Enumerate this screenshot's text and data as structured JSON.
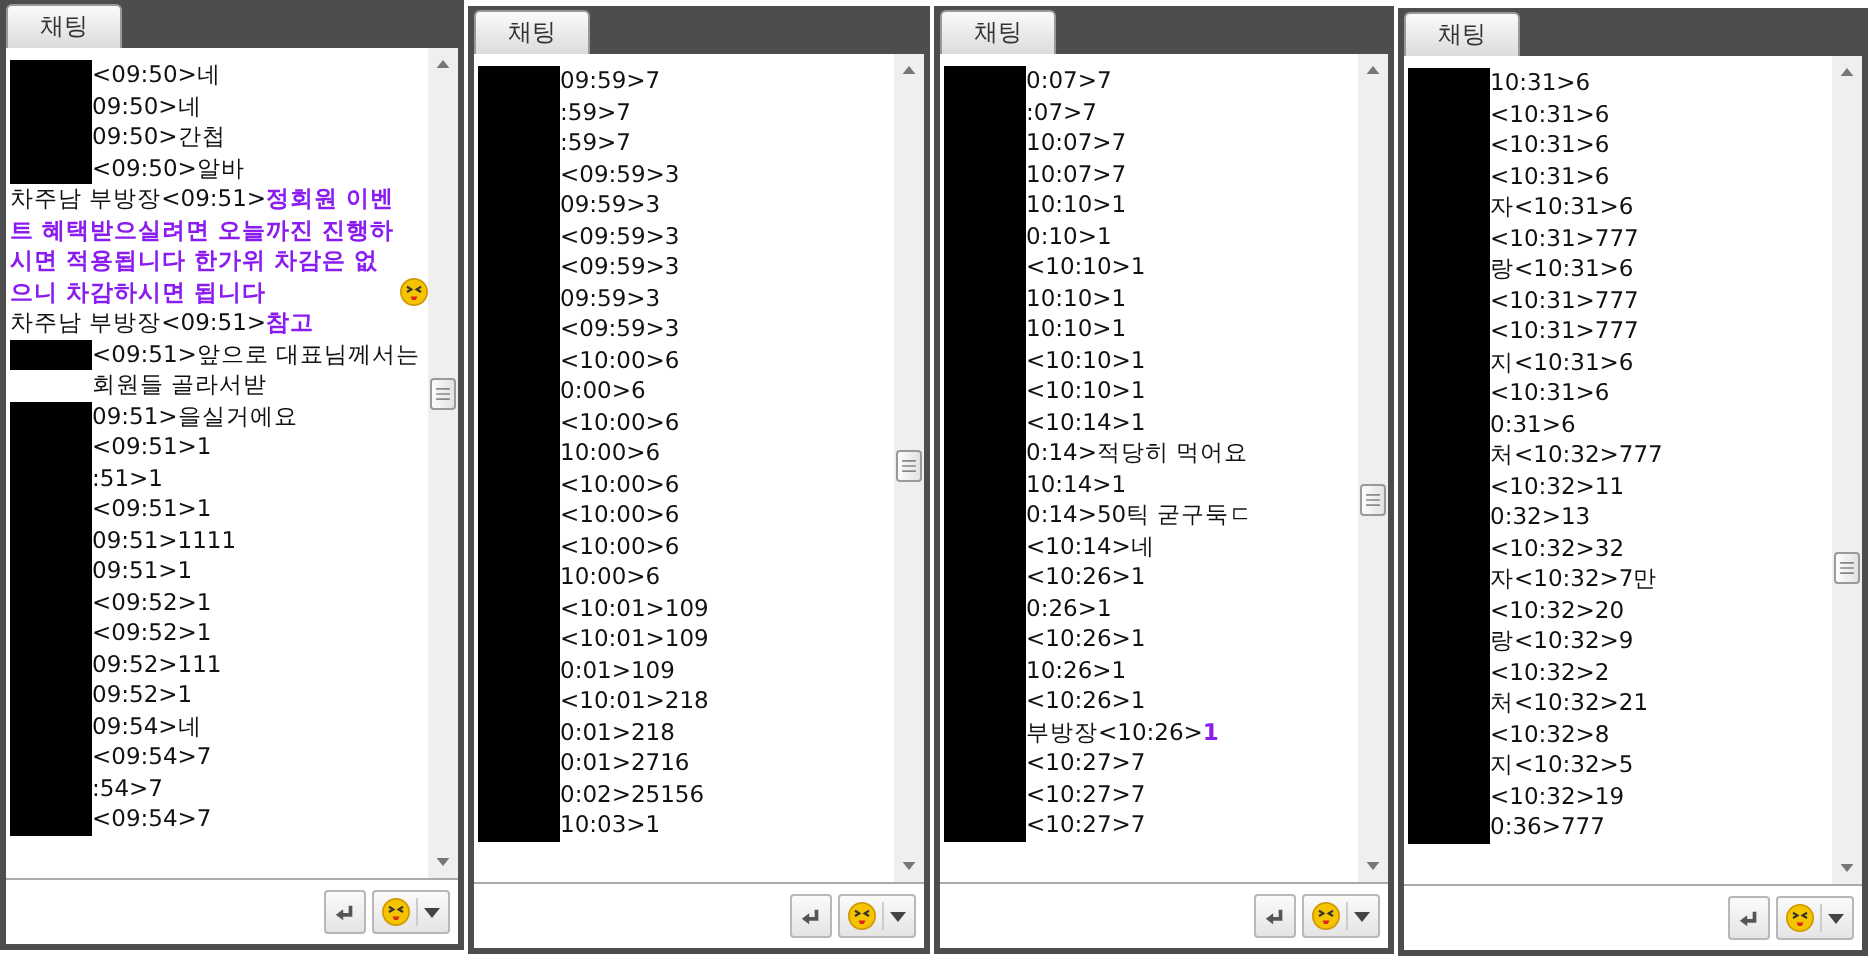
{
  "panels": [
    {
      "tab": "채팅",
      "messages": [
        {
          "redacted": true,
          "text": "<09:50>네"
        },
        {
          "redacted": true,
          "text": "09:50>네"
        },
        {
          "redacted": true,
          "text": "09:50>간첩"
        },
        {
          "redacted": true,
          "text": "<09:50>알바"
        },
        {
          "redacted": false,
          "text": "차주남 부방장<09:51>",
          "notice": "정회원 이벤트 혜택받으실려면 오늘까진 진행하시면 적용됩니다 한가위 차감은 없으니 차감하시면 됩니다",
          "emoticon": true
        },
        {
          "redacted": false,
          "text": "차주남 부방장<09:51>",
          "notice": "참고"
        },
        {
          "redacted": true,
          "text": "<09:51>앞으로 대표님께서는 회원들 골라서받"
        },
        {
          "redacted": true,
          "text": "09:51>을실거에요"
        },
        {
          "redacted": true,
          "text": "<09:51>1"
        },
        {
          "redacted": true,
          "text": ":51>1"
        },
        {
          "redacted": true,
          "text": "<09:51>1"
        },
        {
          "redacted": true,
          "text": "09:51>1111"
        },
        {
          "redacted": true,
          "text": "09:51>1"
        },
        {
          "redacted": true,
          "text": "<09:52>1"
        },
        {
          "redacted": true,
          "text": "<09:52>1"
        },
        {
          "redacted": true,
          "text": "09:52>111"
        },
        {
          "redacted": true,
          "text": "09:52>1"
        },
        {
          "redacted": true,
          "text": "09:54>네"
        },
        {
          "redacted": true,
          "text": "<09:54>7"
        },
        {
          "redacted": true,
          "text": ":54>7"
        },
        {
          "redacted": true,
          "text": "<09:54>7"
        }
      ]
    },
    {
      "tab": "채팅",
      "messages": [
        {
          "redacted": true,
          "text": "09:59>7"
        },
        {
          "redacted": true,
          "text": ":59>7"
        },
        {
          "redacted": true,
          "text": ":59>7"
        },
        {
          "redacted": true,
          "text": "<09:59>3"
        },
        {
          "redacted": true,
          "text": "09:59>3"
        },
        {
          "redacted": true,
          "text": "<09:59>3"
        },
        {
          "redacted": true,
          "text": "<09:59>3"
        },
        {
          "redacted": true,
          "text": "09:59>3"
        },
        {
          "redacted": true,
          "text": "<09:59>3"
        },
        {
          "redacted": true,
          "text": "<10:00>6"
        },
        {
          "redacted": true,
          "text": "0:00>6"
        },
        {
          "redacted": true,
          "text": "<10:00>6"
        },
        {
          "redacted": true,
          "text": "10:00>6"
        },
        {
          "redacted": true,
          "text": "<10:00>6"
        },
        {
          "redacted": true,
          "text": "<10:00>6"
        },
        {
          "redacted": true,
          "text": "<10:00>6"
        },
        {
          "redacted": true,
          "text": "10:00>6"
        },
        {
          "redacted": true,
          "text": "<10:01>109"
        },
        {
          "redacted": true,
          "text": "<10:01>109"
        },
        {
          "redacted": true,
          "text": "0:01>109"
        },
        {
          "redacted": true,
          "text": "<10:01>218"
        },
        {
          "redacted": true,
          "text": "0:01>218"
        },
        {
          "redacted": true,
          "text": "0:01>2716"
        },
        {
          "redacted": true,
          "text": "0:02>25156"
        },
        {
          "redacted": true,
          "text": "10:03>1"
        }
      ]
    },
    {
      "tab": "채팅",
      "messages": [
        {
          "redacted": true,
          "text": "0:07>7"
        },
        {
          "redacted": true,
          "text": ":07>7"
        },
        {
          "redacted": true,
          "text": "10:07>7"
        },
        {
          "redacted": true,
          "text": "10:07>7"
        },
        {
          "redacted": true,
          "text": "10:10>1"
        },
        {
          "redacted": true,
          "text": "0:10>1"
        },
        {
          "redacted": true,
          "text": "<10:10>1"
        },
        {
          "redacted": true,
          "text": "10:10>1"
        },
        {
          "redacted": true,
          "text": "10:10>1"
        },
        {
          "redacted": true,
          "text": "<10:10>1"
        },
        {
          "redacted": true,
          "text": "<10:10>1"
        },
        {
          "redacted": true,
          "text": "<10:14>1"
        },
        {
          "redacted": true,
          "text": "0:14>적당히 먹어요"
        },
        {
          "redacted": true,
          "text": "10:14>1"
        },
        {
          "redacted": true,
          "text": "0:14>50틱 굳구둑ㄷ"
        },
        {
          "redacted": true,
          "text": "<10:14>네"
        },
        {
          "redacted": true,
          "text": "<10:26>1"
        },
        {
          "redacted": true,
          "text": "0:26>1"
        },
        {
          "redacted": true,
          "text": "<10:26>1"
        },
        {
          "redacted": true,
          "text": "10:26>1"
        },
        {
          "redacted": true,
          "text": "<10:26>1"
        },
        {
          "redacted": true,
          "text": "부방장<10:26>",
          "notice": "1"
        },
        {
          "redacted": true,
          "text": "<10:27>7"
        },
        {
          "redacted": true,
          "text": "<10:27>7"
        },
        {
          "redacted": true,
          "text": "<10:27>7"
        }
      ]
    },
    {
      "tab": "채팅",
      "messages": [
        {
          "redacted": true,
          "text": "10:31>6"
        },
        {
          "redacted": true,
          "text": "<10:31>6"
        },
        {
          "redacted": true,
          "text": "<10:31>6"
        },
        {
          "redacted": true,
          "text": "<10:31>6"
        },
        {
          "redacted": true,
          "text": "자<10:31>6"
        },
        {
          "redacted": true,
          "text": "<10:31>777"
        },
        {
          "redacted": true,
          "text": "랑<10:31>6"
        },
        {
          "redacted": true,
          "text": "<10:31>777"
        },
        {
          "redacted": true,
          "text": "<10:31>777"
        },
        {
          "redacted": true,
          "text": "지<10:31>6"
        },
        {
          "redacted": true,
          "text": "<10:31>6"
        },
        {
          "redacted": true,
          "text": "0:31>6"
        },
        {
          "redacted": true,
          "text": "처<10:32>777"
        },
        {
          "redacted": true,
          "text": "<10:32>11"
        },
        {
          "redacted": true,
          "text": "0:32>13"
        },
        {
          "redacted": true,
          "text": "<10:32>32"
        },
        {
          "redacted": true,
          "text": "자<10:32>7만"
        },
        {
          "redacted": true,
          "text": "<10:32>20"
        },
        {
          "redacted": true,
          "text": "랑<10:32>9"
        },
        {
          "redacted": true,
          "text": "<10:32>2"
        },
        {
          "redacted": true,
          "text": "처<10:32>21"
        },
        {
          "redacted": true,
          "text": "<10:32>8"
        },
        {
          "redacted": true,
          "text": "지<10:32>5"
        },
        {
          "redacted": true,
          "text": "<10:32>19"
        },
        {
          "redacted": true,
          "text": "0:36>777"
        }
      ]
    }
  ]
}
